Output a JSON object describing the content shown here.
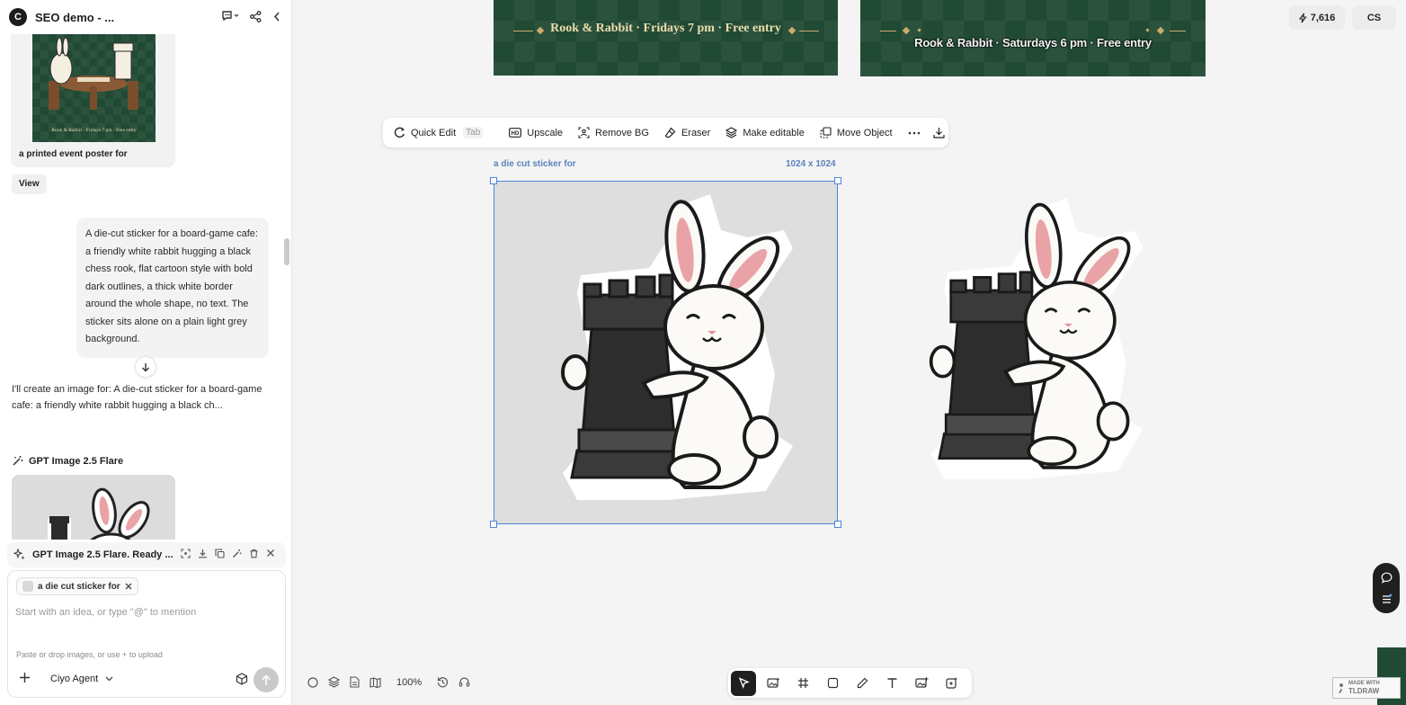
{
  "sidebar": {
    "logo_letter": "C",
    "project_title": "SEO demo - ...",
    "card1": {
      "poster_text": "Rook & Rabbit · Fridays 7 pm · Free entry",
      "caption": "a printed event poster for",
      "view_label": "View"
    },
    "user_message": "A die-cut sticker for a board-game cafe: a friendly white rabbit hugging a black chess rook, flat cartoon style with bold dark outlines, a thick white border around the whole shape, no text. The sticker sits alone on a plain light grey background.",
    "assistant_message": "I'll create an image for: A die-cut sticker for a board-game cafe: a friendly white rabbit hugging a black ch...",
    "model_name": "GPT Image 2.5 Flare",
    "status_text": "GPT Image 2.5 Flare. Ready ...",
    "composer": {
      "chip_label": "a die cut sticker for",
      "placeholder": "Start with an idea, or type \"@\" to mention",
      "upload_hint": "Paste or drop images, or use + to upload",
      "agent_label": "Ciyo Agent"
    }
  },
  "canvas": {
    "poster_a_text": "Rook & Rabbit  ·  Fridays 7 pm  ·  Free entry",
    "poster_b_text": "Rook & Rabbit · Saturdays 6 pm · Free entry",
    "toolbar": {
      "quick_edit": "Quick Edit",
      "quick_edit_key": "Tab",
      "upscale": "Upscale",
      "remove_bg": "Remove BG",
      "eraser": "Eraser",
      "make_editable": "Make editable",
      "move_object": "Move Object"
    },
    "selection_caption": "a die cut sticker for",
    "selection_size": "1024 x 1024",
    "credits": "7,616",
    "user_initials": "CS",
    "zoom_level": "100%",
    "badge_line1": "MADE WITH",
    "badge_line2": "TLDRAW"
  },
  "colors": {
    "poster_green": "#214a34",
    "selection_blue": "#4a86d9",
    "gold": "#c9ad6c"
  }
}
